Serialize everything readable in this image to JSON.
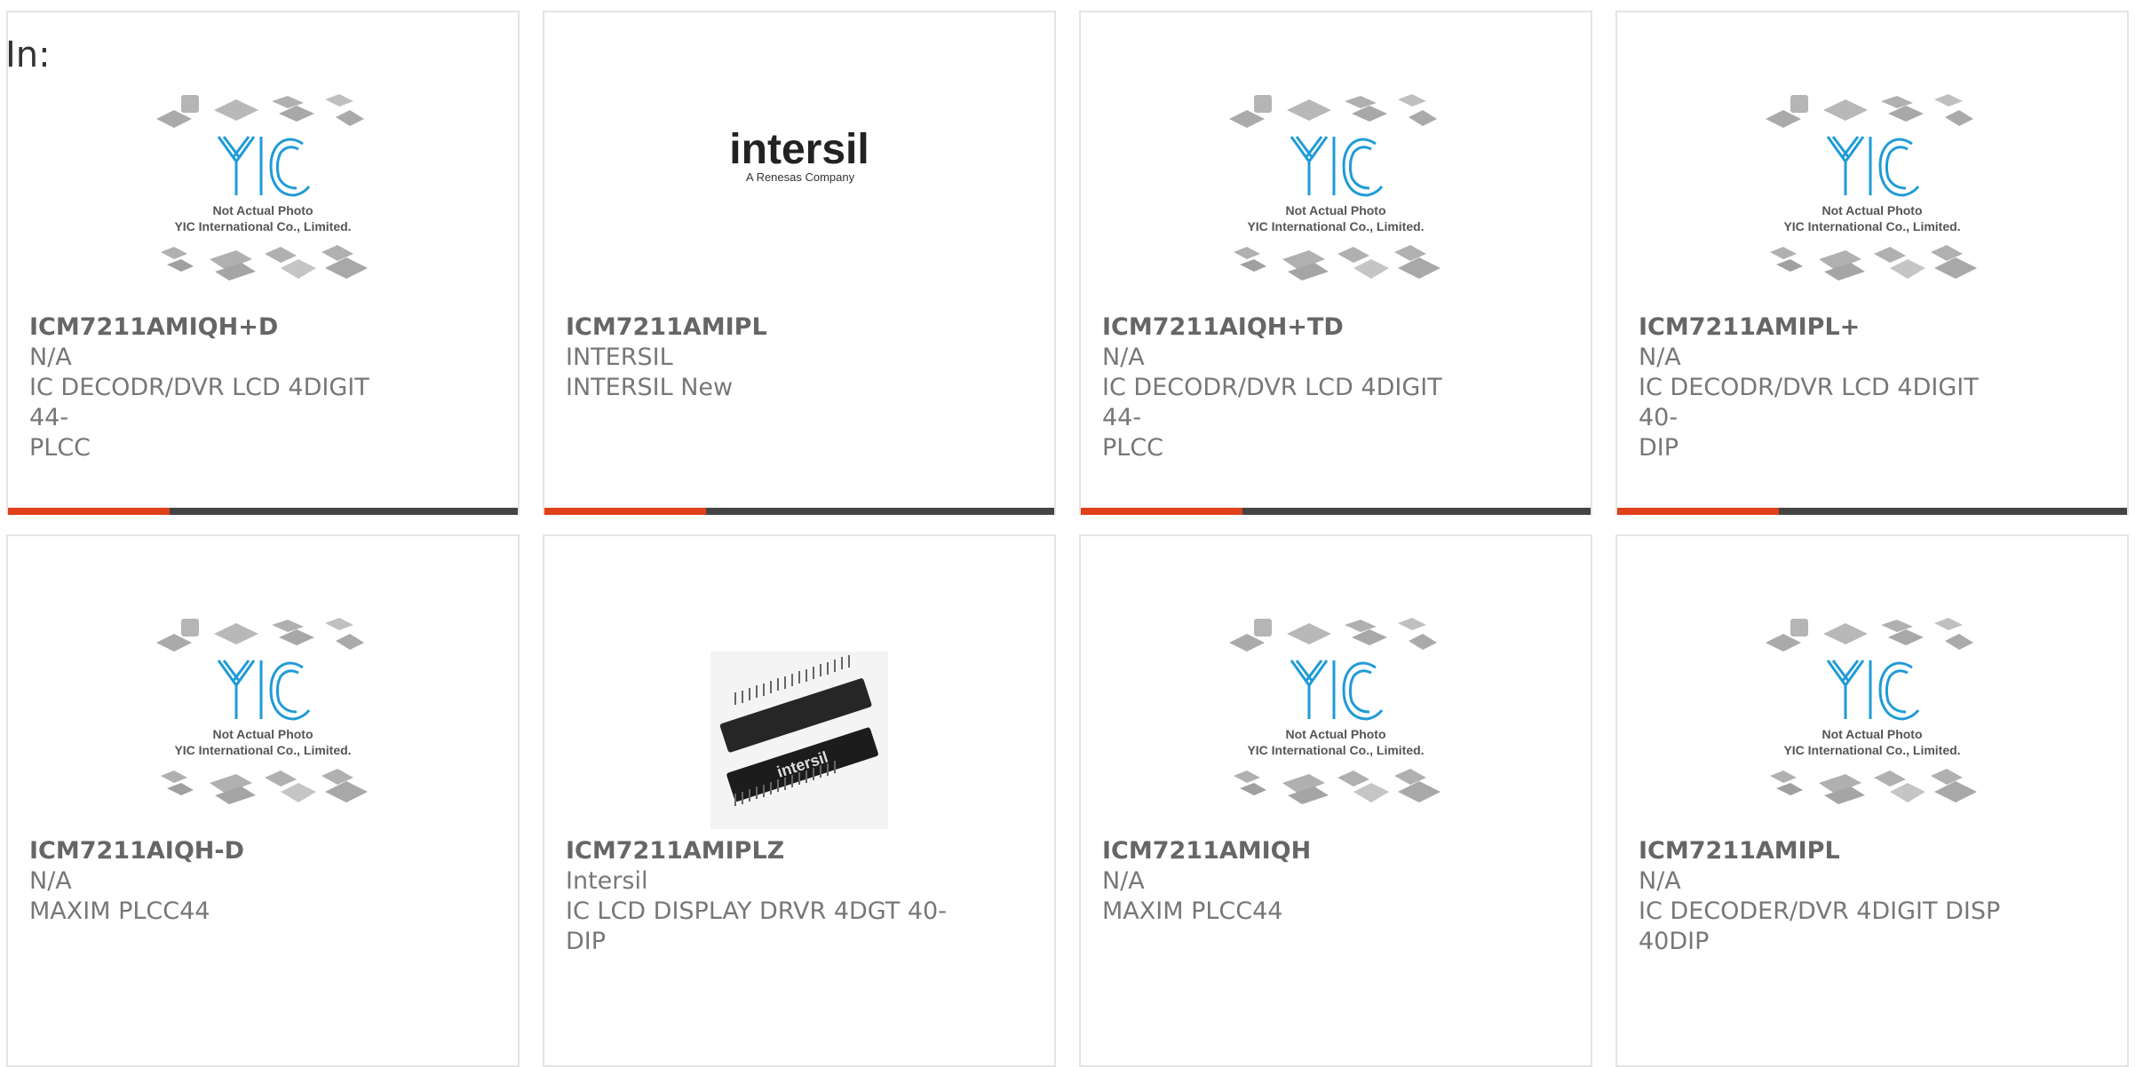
{
  "in_label": "In:",
  "placeholder": {
    "line1": "Not Actual Photo",
    "line2": "YIC International Co., Limited.",
    "logo": "YIC"
  },
  "intersil_logo": {
    "brand": "intersil",
    "tagline": "A Renesas Company"
  },
  "chip_photo_text": "intersil",
  "colors": {
    "accent": "#e0401a",
    "bar": "#444444",
    "logo_blue": "#1f9bd7"
  },
  "products": [
    {
      "part": "ICM7211AMIQH+D",
      "mfr": "N/A",
      "desc1": "IC DECODR/DVR LCD 4DIGIT 44-",
      "desc2": "PLCC",
      "image": "placeholder"
    },
    {
      "part": "ICM7211AMIPL",
      "mfr": "INTERSIL",
      "desc1": "INTERSIL New",
      "desc2": "",
      "image": "intersil-logo"
    },
    {
      "part": "ICM7211AIQH+TD",
      "mfr": "N/A",
      "desc1": "IC DECODR/DVR LCD 4DIGIT 44-",
      "desc2": "PLCC",
      "image": "placeholder"
    },
    {
      "part": "ICM7211AMIPL+",
      "mfr": "N/A",
      "desc1": "IC DECODR/DVR LCD 4DIGIT 40-",
      "desc2": "DIP",
      "image": "placeholder"
    },
    {
      "part": "ICM7211AIQH-D",
      "mfr": "N/A",
      "desc1": "MAXIM PLCC44",
      "desc2": "",
      "image": "placeholder"
    },
    {
      "part": "ICM7211AMIPLZ",
      "mfr": "Intersil",
      "desc1": "IC LCD DISPLAY DRVR 4DGT 40-",
      "desc2": "DIP",
      "image": "chip-photo"
    },
    {
      "part": "ICM7211AMIQH",
      "mfr": "N/A",
      "desc1": "MAXIM PLCC44",
      "desc2": "",
      "image": "placeholder"
    },
    {
      "part": "ICM7211AMIPL",
      "mfr": "N/A",
      "desc1": "IC DECODER/DVR 4DIGIT DISP",
      "desc2": "40DIP",
      "image": "placeholder"
    }
  ]
}
